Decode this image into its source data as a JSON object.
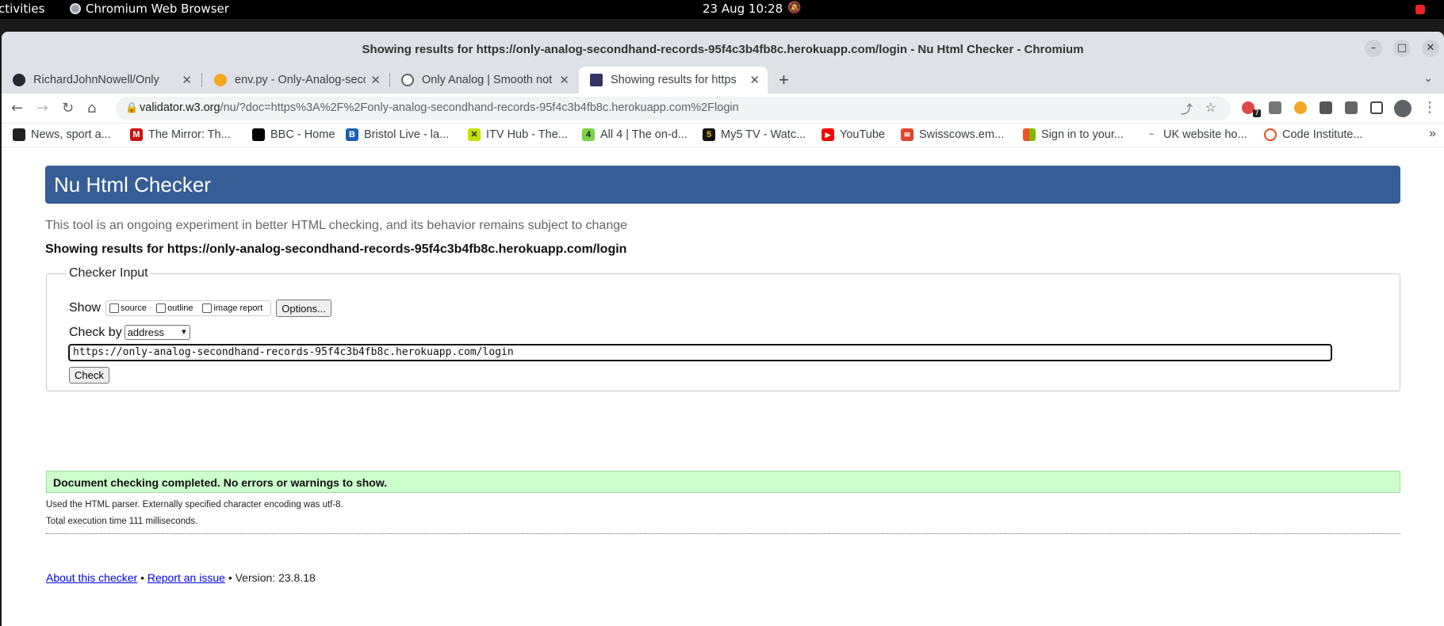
{
  "os": {
    "activities": "ctivities",
    "app_name": "Chromium Web Browser",
    "clock": "23 Aug  10:28"
  },
  "window": {
    "title": "Showing results for https://only-analog-secondhand-records-95f4c3b4fb8c.herokuapp.com/login - Nu Html Checker - Chromium"
  },
  "tabs": [
    {
      "label": "RichardJohnNowell/Only",
      "icon_color": "#24292f",
      "active": false
    },
    {
      "label": "env.py - Only-Analog-seco",
      "icon_color": "#f5a623",
      "active": false
    },
    {
      "label": "Only Analog | Smooth not",
      "icon_color": "#5f6368",
      "active": false
    },
    {
      "label": "Showing results for https",
      "icon_color": "#333366",
      "active": true
    }
  ],
  "address_bar": {
    "host": "validator.w3.org",
    "rest": "/nu/?doc=https%3A%2F%2Fonly-analog-secondhand-records-95f4c3b4fb8c.herokuapp.com%2Flogin",
    "extension_badge": "7"
  },
  "bookmarks": [
    {
      "label": "News, sport a...",
      "icon_color": "#202124",
      "icon_char": "◐"
    },
    {
      "label": "The Mirror: Th...",
      "icon_color": "#cc1111",
      "icon_char": "M"
    },
    {
      "label": "BBC - Home",
      "icon_color": "#000000",
      "icon_char": "▪▪▪"
    },
    {
      "label": "Bristol Live - la...",
      "icon_color": "#1a5fb4",
      "icon_char": "B"
    },
    {
      "label": "ITV Hub - The...",
      "icon_color": "#c6e000",
      "icon_char": "✕"
    },
    {
      "label": "All 4 | The on-d...",
      "icon_color": "#7bd148",
      "icon_char": "4"
    },
    {
      "label": "My5 TV - Watc...",
      "icon_color": "#111111",
      "icon_char": "5"
    },
    {
      "label": "YouTube",
      "icon_color": "#ff0000",
      "icon_char": "▶"
    },
    {
      "label": "Swisscows.em...",
      "icon_color": "#e0452b",
      "icon_char": "✉"
    },
    {
      "label": "Sign in to your...",
      "icon_color": "#f25022",
      "icon_char": "■"
    },
    {
      "label": "UK website ho...",
      "icon_color": "#4a7fd0",
      "icon_char": "~"
    },
    {
      "label": "Code Institute...",
      "icon_color": "#e8491d",
      "icon_char": "○"
    }
  ],
  "page": {
    "heading": "Nu Html Checker",
    "subtitle": "This tool is an ongoing experiment in better HTML checking, and its behavior remains subject to change",
    "results_for": "Showing results for https://only-analog-secondhand-records-95f4c3b4fb8c.herokuapp.com/login",
    "checker_input": {
      "legend": "Checker Input",
      "show_label": "Show",
      "checkboxes": [
        "source",
        "outline",
        "image report"
      ],
      "options_button": "Options...",
      "check_by_label": "Check by",
      "check_by_value": "address",
      "url_value": "https://only-analog-secondhand-records-95f4c3b4fb8c.herokuapp.com/login",
      "check_button": "Check"
    },
    "success_message": "Document checking completed. No errors or warnings to show.",
    "parser_info": "Used the HTML parser. Externally specified character encoding was utf-8.",
    "execution_time": "Total execution time 111 milliseconds.",
    "footer": {
      "about_link": "About this checker",
      "sep": "•",
      "report_link": "Report an issue",
      "version": "• Version: 23.8.18"
    }
  },
  "colors": {
    "header_bg": "#365d95",
    "success_bg": "#ccffcc"
  }
}
